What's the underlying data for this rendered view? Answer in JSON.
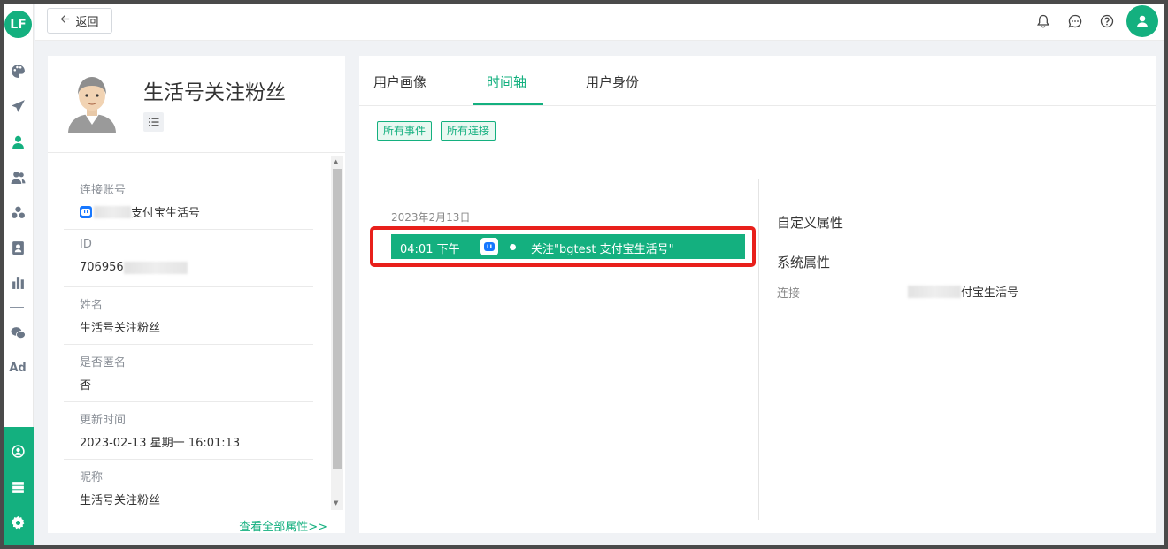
{
  "app": {
    "logo_text": "LF",
    "accent": "#14b07f",
    "highlight": "#e8201b"
  },
  "rail": {
    "items": [
      {
        "icon": "palette-icon"
      },
      {
        "icon": "send-icon"
      },
      {
        "icon": "user-icon"
      },
      {
        "icon": "users-icon"
      },
      {
        "icon": "groups-icon"
      },
      {
        "icon": "contact-card-icon"
      },
      {
        "icon": "bar-chart-icon"
      },
      {
        "icon": "wechat-icon"
      },
      {
        "label": "Ad"
      }
    ],
    "bottom_items": [
      {
        "icon": "network-icon"
      },
      {
        "icon": "server-icon"
      },
      {
        "icon": "settings-icon"
      }
    ]
  },
  "topbar": {
    "back_label": "返回",
    "icons": [
      "bell-icon",
      "message-icon",
      "help-icon",
      "user-avatar-icon"
    ]
  },
  "profile": {
    "name": "生活号关注粉丝",
    "attributes": [
      {
        "label": "连接账号",
        "value": "支付宝生活号"
      },
      {
        "label": "ID",
        "value": "706956"
      },
      {
        "label": "姓名",
        "value": "生活号关注粉丝"
      },
      {
        "label": "是否匿名",
        "value": "否"
      },
      {
        "label": "更新时间",
        "value": "2023-02-13 星期一 16:01:13"
      },
      {
        "label": "昵称",
        "value": "生活号关注粉丝"
      }
    ],
    "view_all": "查看全部属性>>"
  },
  "tabs": {
    "items": [
      "用户画像",
      "时间轴",
      "用户身份"
    ],
    "active": "时间轴"
  },
  "filters": [
    "所有事件",
    "所有连接"
  ],
  "timeline": {
    "date": "2023年2月13日",
    "event": {
      "time": "04:01 下午",
      "text": "关注\"bgtest 支付宝生活号\""
    }
  },
  "properties": {
    "custom_title": "自定义属性",
    "system_title": "系统属性",
    "connection_key": "连接",
    "connection_value": "付宝生活号"
  }
}
